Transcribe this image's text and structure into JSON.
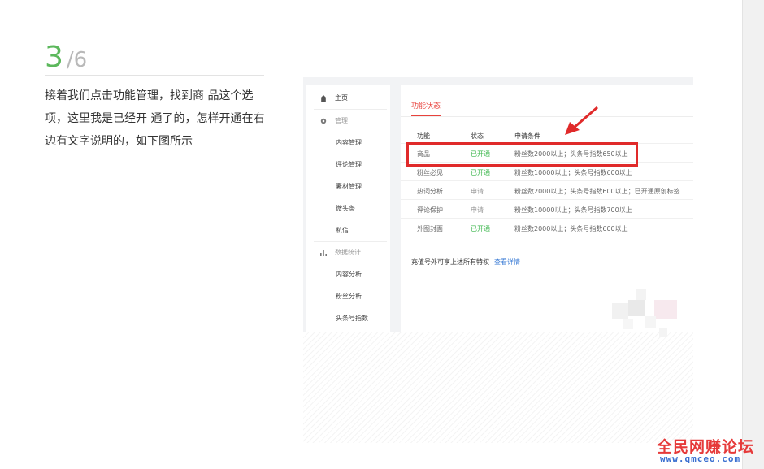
{
  "step": {
    "current": "3",
    "total": "/6"
  },
  "description": "接着我们点击功能管理，找到商 品这个选项，这里我是已经开 通了的，怎样开通在右边有文字说明的，如下图所示",
  "screenshot": {
    "sidebar": {
      "home": {
        "label": "主页",
        "icon": "home-icon"
      },
      "manage": {
        "label": "管理",
        "icon": "gear-icon"
      },
      "manage_items": [
        "内容管理",
        "评论管理",
        "素材管理",
        "微头条",
        "私信"
      ],
      "stats": {
        "label": "数据统计",
        "icon": "bar-chart-icon"
      },
      "stats_items": [
        "内容分析",
        "粉丝分析",
        "头条号指数"
      ]
    },
    "tab": "功能状态",
    "table": {
      "headers": [
        "功能",
        "状态",
        "申请条件"
      ],
      "rows": [
        {
          "feature": "商品",
          "status": "已开通",
          "status_type": "open",
          "condition": "粉丝数2000以上；头条号指数650以上"
        },
        {
          "feature": "粉丝必见",
          "status": "已开通",
          "status_type": "open",
          "condition": "粉丝数10000以上；头条号指数600以上"
        },
        {
          "feature": "热词分析",
          "status": "申请",
          "status_type": "apply",
          "condition": "粉丝数2000以上；头条号指数600以上；已开通原创标签"
        },
        {
          "feature": "评论保护",
          "status": "申请",
          "status_type": "apply",
          "condition": "粉丝数10000以上；头条号指数700以上"
        },
        {
          "feature": "外图封面",
          "status": "已开通",
          "status_type": "open",
          "condition": "粉丝数2000以上；头条号指数600以上"
        }
      ]
    },
    "footer_note": "充值号外可享上述所有特权",
    "footer_link": "查看详情"
  },
  "brand": {
    "name": "全民网赚论坛",
    "url": "www.qmceo.com"
  },
  "colors": {
    "accent_green": "#5cb85c",
    "highlight_red": "#e02a2a",
    "tab_red": "#e8423c",
    "link_blue": "#3a7bd5"
  }
}
